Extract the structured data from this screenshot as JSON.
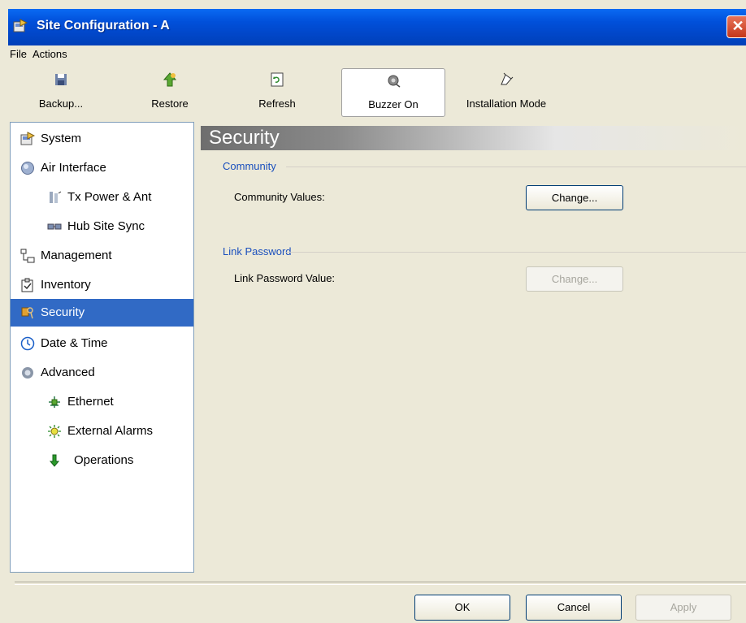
{
  "window": {
    "title": "Site Configuration - A"
  },
  "menu": {
    "file": "File",
    "actions": "Actions"
  },
  "toolbar": {
    "backup": "Backup...",
    "restore": "Restore",
    "refresh": "Refresh",
    "buzzer": "Buzzer On",
    "installation": "Installation Mode"
  },
  "sidebar": {
    "items": [
      {
        "label": "System",
        "icon": "system-icon"
      },
      {
        "label": "Air Interface",
        "icon": "air-interface-icon"
      },
      {
        "label": "Tx Power & Ant",
        "icon": "antenna-icon"
      },
      {
        "label": "Hub Site Sync",
        "icon": "sync-icon"
      },
      {
        "label": "Management",
        "icon": "management-icon"
      },
      {
        "label": "Inventory",
        "icon": "inventory-icon"
      },
      {
        "label": "Security",
        "icon": "security-icon",
        "selected": true
      },
      {
        "label": "Date & Time",
        "icon": "clock-icon"
      },
      {
        "label": "Advanced",
        "icon": "gear-icon"
      },
      {
        "label": "Ethernet",
        "icon": "ethernet-icon"
      },
      {
        "label": "External Alarms",
        "icon": "alarm-icon"
      },
      {
        "label": "Operations",
        "icon": "arrow-down-icon"
      }
    ]
  },
  "content": {
    "title": "Security",
    "community": {
      "group": "Community",
      "field_label": "Community Values:",
      "button": "Change..."
    },
    "link_password": {
      "group": "Link Password",
      "field_label": "Link Password Value:",
      "button": "Change..."
    }
  },
  "footer": {
    "ok": "OK",
    "cancel": "Cancel",
    "apply": "Apply"
  },
  "colors": {
    "title_bar": "#0150da",
    "selection": "#316ac5",
    "group_label": "#1a4fbd"
  }
}
